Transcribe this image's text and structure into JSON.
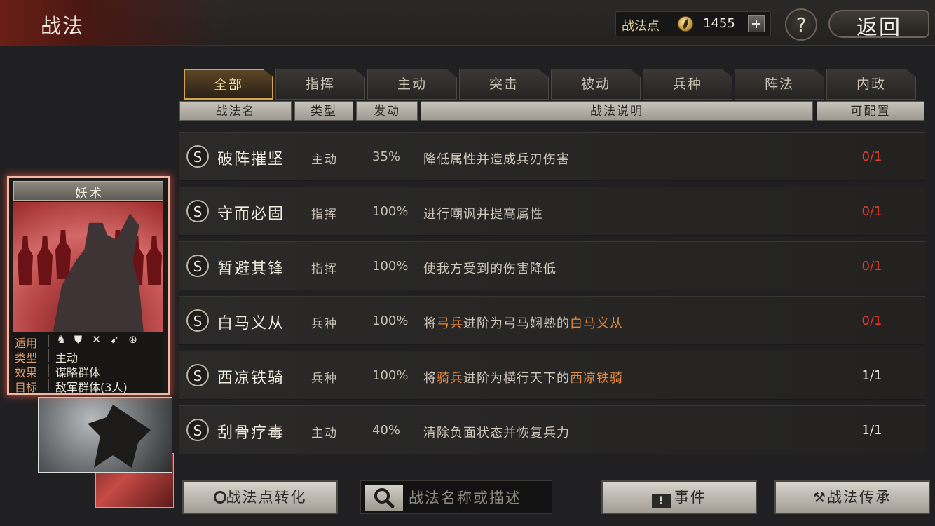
{
  "header": {
    "title": "战法",
    "points_label": "战法点",
    "points_value": "1455",
    "help_label": "?",
    "back_label": "返回"
  },
  "tabs": [
    {
      "label": "全部",
      "active": true
    },
    {
      "label": "指挥",
      "active": false
    },
    {
      "label": "主动",
      "active": false
    },
    {
      "label": "突击",
      "active": false
    },
    {
      "label": "被动",
      "active": false
    },
    {
      "label": "兵种",
      "active": false
    },
    {
      "label": "阵法",
      "active": false
    },
    {
      "label": "内政",
      "active": false
    }
  ],
  "columns": {
    "name": "战法名",
    "type": "类型",
    "rate": "发动",
    "desc": "战法说明",
    "config": "可配置"
  },
  "rows": [
    {
      "grade": "S",
      "name": "破阵摧坚",
      "type": "主动",
      "rate": "35%",
      "desc": [
        {
          "t": "降低属性并造成兵刃伤害"
        }
      ],
      "config": "0/1",
      "config_color": "#e03b2e"
    },
    {
      "grade": "S",
      "name": "守而必固",
      "type": "指挥",
      "rate": "100%",
      "desc": [
        {
          "t": "进行嘲讽并提高属性"
        }
      ],
      "config": "0/1",
      "config_color": "#e03b2e"
    },
    {
      "grade": "S",
      "name": "暂避其锋",
      "type": "指挥",
      "rate": "100%",
      "desc": [
        {
          "t": "使我方受到的伤害降低"
        }
      ],
      "config": "0/1",
      "config_color": "#e03b2e"
    },
    {
      "grade": "S",
      "name": "白马义从",
      "type": "兵种",
      "rate": "100%",
      "desc": [
        {
          "t": "将"
        },
        {
          "t": "弓兵",
          "hl": true
        },
        {
          "t": "进阶为弓马娴熟的"
        },
        {
          "t": "白马义从",
          "hl": true
        }
      ],
      "config": "0/1",
      "config_color": "#e03b2e"
    },
    {
      "grade": "S",
      "name": "西凉铁骑",
      "type": "兵种",
      "rate": "100%",
      "desc": [
        {
          "t": "将"
        },
        {
          "t": "骑兵",
          "hl": true
        },
        {
          "t": "进阶为横行天下的"
        },
        {
          "t": "西凉铁骑",
          "hl": true
        }
      ],
      "config": "1/1",
      "config_color": "#f0ebe0"
    },
    {
      "grade": "S",
      "name": "刮骨疗毒",
      "type": "主动",
      "rate": "40%",
      "desc": [
        {
          "t": "清除负面状态并恢复兵力"
        }
      ],
      "config": "1/1",
      "config_color": "#f0ebe0"
    }
  ],
  "card": {
    "title": "妖术",
    "applicable_label": "适用",
    "applicable_icons": [
      "cavalry-icon",
      "shield-icon",
      "crossed-bows-icon",
      "spear-icon",
      "wheel-icon"
    ],
    "type_label": "类型",
    "type_value": "主动",
    "effect_label": "效果",
    "effect_value": "谋略群体",
    "target_label": "目标",
    "target_value": "敌军群体(3人)"
  },
  "bottom": {
    "convert_label": "战法点转化",
    "search_placeholder": "战法名称或描述",
    "event_label": "事件",
    "inherit_label": "战法传承"
  }
}
